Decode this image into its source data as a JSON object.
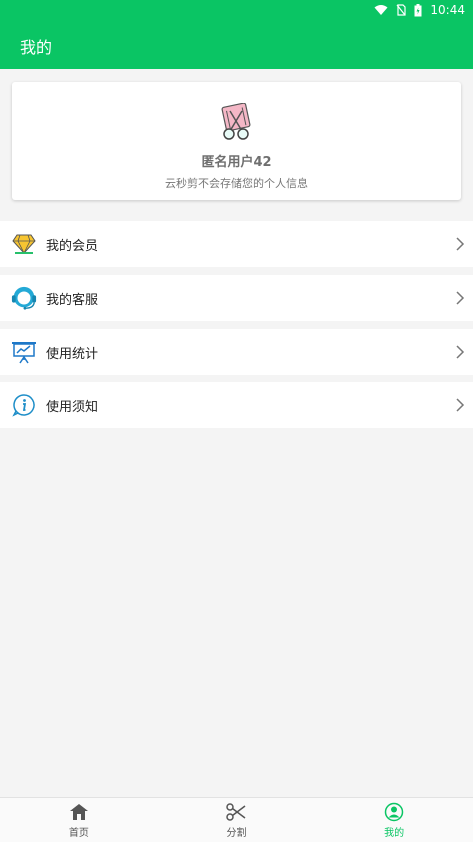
{
  "status_bar": {
    "time": "10:44"
  },
  "app_bar": {
    "title": "我的",
    "color": "#0ac564"
  },
  "profile": {
    "username": "匿名用户42",
    "hint": "云秒剪不会存储您的个人信息",
    "avatar_icon": "scissors-film-icon"
  },
  "menu": {
    "items": [
      {
        "label": "我的会员",
        "icon": "diamond-icon"
      },
      {
        "label": "我的客服",
        "icon": "customer-service-icon"
      },
      {
        "label": "使用统计",
        "icon": "chart-board-icon"
      },
      {
        "label": "使用须知",
        "icon": "info-icon"
      }
    ]
  },
  "bottom_nav": {
    "items": [
      {
        "label": "首页",
        "icon": "home-icon",
        "active": false
      },
      {
        "label": "分割",
        "icon": "scissors-icon",
        "active": false
      },
      {
        "label": "我的",
        "icon": "user-icon",
        "active": true
      }
    ]
  }
}
